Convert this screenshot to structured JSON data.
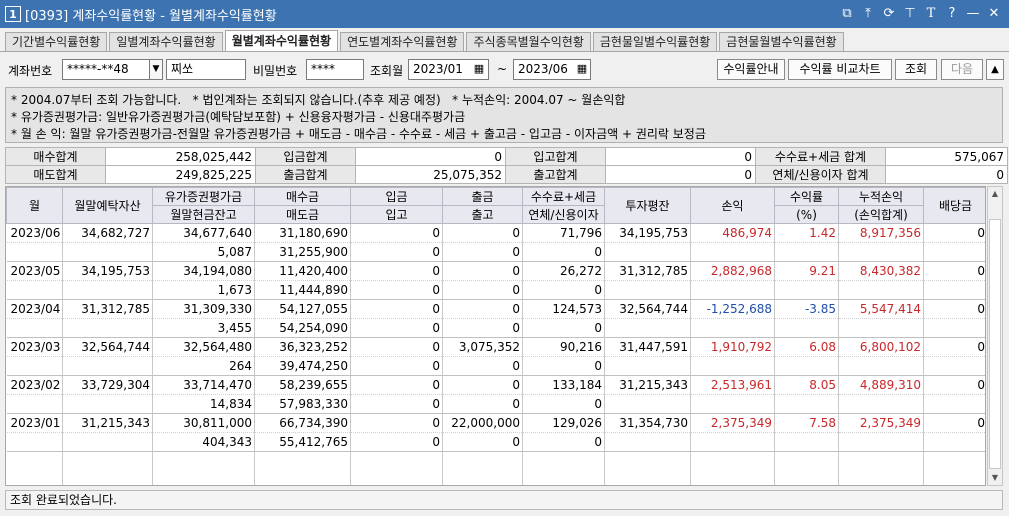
{
  "window": {
    "number": "1",
    "title": "[0393] 계좌수익률현황 - 월별계좌수익률현황",
    "icons": [
      "restore-windows-icon",
      "pin-top-icon",
      "link-icon",
      "pin-icon",
      "text-size-icon",
      "help-icon",
      "minimize-icon",
      "close-icon"
    ]
  },
  "tabs": [
    "기간별수익률현황",
    "일별계좌수익률현황",
    "월별계좌수익률현황",
    "연도별계좌수익률현황",
    "주식종목별월수익현황",
    "금현물일별수익률현황",
    "금현물월별수익률현황"
  ],
  "form": {
    "account_label": "계좌번호",
    "account_value": "*****-**48",
    "account_name": "찌쏘",
    "password_label": "비밀번호",
    "password_value": "****",
    "month_label": "조회월",
    "month_from": "2023/01",
    "month_sep": "~",
    "month_to": "2023/06",
    "btn_guide": "수익률안내",
    "btn_compare": "수익률 비교차트",
    "btn_search": "조회",
    "btn_next": "다음",
    "btn_up": "▲"
  },
  "info": {
    "line1": "* 2004.07부터 조회 가능합니다.   * 법인계좌는 조회되지 않습니다.(추후 제공 예정)   * 누적손익: 2004.07 ~ 월손익합",
    "line2": "* 유가증권평가금: 일반유가증권평가금(예탁담보포함) + 신용융자평가금 - 신용대주평가금",
    "line3": "* 월 손 익: 월말 유가증권평가금-전월말 유가증권평가금 + 매도금 - 매수금 - 수수료 - 세금 + 출고금 - 입고금 - 이자금액 + 권리락 보정금"
  },
  "summary": {
    "buy_total_label": "매수합계",
    "buy_total": "258,025,442",
    "deposit_total_label": "입금합계",
    "deposit_total": "0",
    "in_total_label": "입고합계",
    "in_total": "0",
    "fee_total_label": "수수료+세금 합계",
    "fee_total": "575,067",
    "sell_total_label": "매도합계",
    "sell_total": "249,825,225",
    "withdraw_total_label": "출금합계",
    "withdraw_total": "25,075,352",
    "out_total_label": "출고합계",
    "out_total": "0",
    "interest_total_label": "연체/신용이자 합계",
    "interest_total": "0"
  },
  "grid": {
    "headers": {
      "month": "월",
      "eom_deposit": "월말예탁자산",
      "sec_eval_1": "유가증권평가금",
      "sec_eval_2": "월말현금잔고",
      "buy_1": "매수금",
      "buy_2": "매도금",
      "in_1": "입금",
      "in_2": "입고",
      "out_1": "출금",
      "out_2": "출고",
      "fee_1": "수수료+세금",
      "fee_2": "연체/신용이자",
      "avg_invest": "투자평잔",
      "pnl": "손익",
      "rate_1": "수익률",
      "rate_2": "(%)",
      "cum_1": "누적손익",
      "cum_2": "(손익합계)",
      "dividend": "배당금"
    },
    "rows": [
      {
        "month": "2023/06",
        "eom_deposit": "34,682,727",
        "sec_eval": "34,677,640",
        "cash": "5,087",
        "buy": "31,180,690",
        "sell": "31,255,900",
        "deposit": "0",
        "in": "0",
        "withdraw": "0",
        "out": "0",
        "fee": "71,796",
        "interest": "0",
        "avg_invest": "34,195,753",
        "pnl": "486,974",
        "rate": "1.42",
        "cum": "8,917,356",
        "dividend": "0"
      },
      {
        "month": "2023/05",
        "eom_deposit": "34,195,753",
        "sec_eval": "34,194,080",
        "cash": "1,673",
        "buy": "11,420,400",
        "sell": "11,444,890",
        "deposit": "0",
        "in": "0",
        "withdraw": "0",
        "out": "0",
        "fee": "26,272",
        "interest": "0",
        "avg_invest": "31,312,785",
        "pnl": "2,882,968",
        "rate": "9.21",
        "cum": "8,430,382",
        "dividend": "0"
      },
      {
        "month": "2023/04",
        "eom_deposit": "31,312,785",
        "sec_eval": "31,309,330",
        "cash": "3,455",
        "buy": "54,127,055",
        "sell": "54,254,090",
        "deposit": "0",
        "in": "0",
        "withdraw": "0",
        "out": "0",
        "fee": "124,573",
        "interest": "0",
        "avg_invest": "32,564,744",
        "pnl": "-1,252,688",
        "rate": "-3.85",
        "cum": "5,547,414",
        "dividend": "0"
      },
      {
        "month": "2023/03",
        "eom_deposit": "32,564,744",
        "sec_eval": "32,564,480",
        "cash": "264",
        "buy": "36,323,252",
        "sell": "39,474,250",
        "deposit": "0",
        "in": "0",
        "withdraw": "3,075,352",
        "out": "0",
        "fee": "90,216",
        "interest": "0",
        "avg_invest": "31,447,591",
        "pnl": "1,910,792",
        "rate": "6.08",
        "cum": "6,800,102",
        "dividend": "0"
      },
      {
        "month": "2023/02",
        "eom_deposit": "33,729,304",
        "sec_eval": "33,714,470",
        "cash": "14,834",
        "buy": "58,239,655",
        "sell": "57,983,330",
        "deposit": "0",
        "in": "0",
        "withdraw": "0",
        "out": "0",
        "fee": "133,184",
        "interest": "0",
        "avg_invest": "31,215,343",
        "pnl": "2,513,961",
        "rate": "8.05",
        "cum": "4,889,310",
        "dividend": "0"
      },
      {
        "month": "2023/01",
        "eom_deposit": "31,215,343",
        "sec_eval": "30,811,000",
        "cash": "404,343",
        "buy": "66,734,390",
        "sell": "55,412,765",
        "deposit": "0",
        "in": "0",
        "withdraw": "22,000,000",
        "out": "0",
        "fee": "129,026",
        "interest": "0",
        "avg_invest": "31,354,730",
        "pnl": "2,375,349",
        "rate": "7.58",
        "cum": "2,375,349",
        "dividend": "0"
      }
    ]
  },
  "status": "조회 완료되었습니다.",
  "colors": {
    "title_bar": "#3d73b0",
    "positive": "#c8282a",
    "negative": "#1f4fa8"
  }
}
